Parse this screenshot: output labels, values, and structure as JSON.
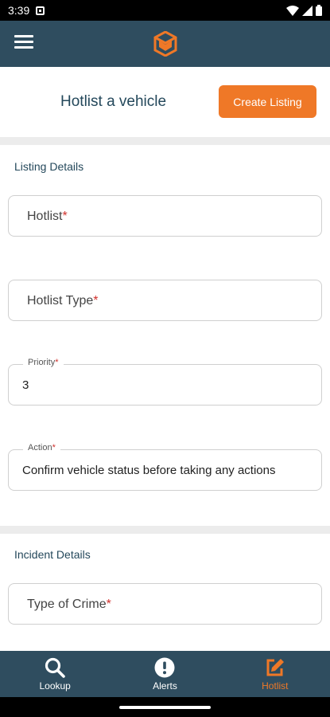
{
  "status_bar": {
    "time": "3:39"
  },
  "header": {
    "title": "Hotlist a vehicle",
    "create_button": "Create Listing"
  },
  "listing_details": {
    "title": "Listing Details",
    "hotlist": {
      "label": "Hotlist",
      "required": "*"
    },
    "hotlist_type": {
      "label": "Hotlist Type",
      "required": "*"
    },
    "priority": {
      "label": "Priority",
      "required": "*",
      "value": "3"
    },
    "action": {
      "label": "Action",
      "required": "*",
      "value": "Confirm vehicle status before taking any actions"
    }
  },
  "incident_details": {
    "title": "Incident Details",
    "type_of_crime": {
      "label": "Type of Crime",
      "required": "*"
    }
  },
  "bottom_nav": {
    "items": [
      {
        "label": "Lookup",
        "icon": "search-icon"
      },
      {
        "label": "Alerts",
        "icon": "alert-icon"
      },
      {
        "label": "Hotlist",
        "icon": "edit-icon",
        "active": true
      }
    ]
  },
  "colors": {
    "primary": "#2f4d5f",
    "accent": "#ef7827",
    "required": "#d0312d"
  }
}
